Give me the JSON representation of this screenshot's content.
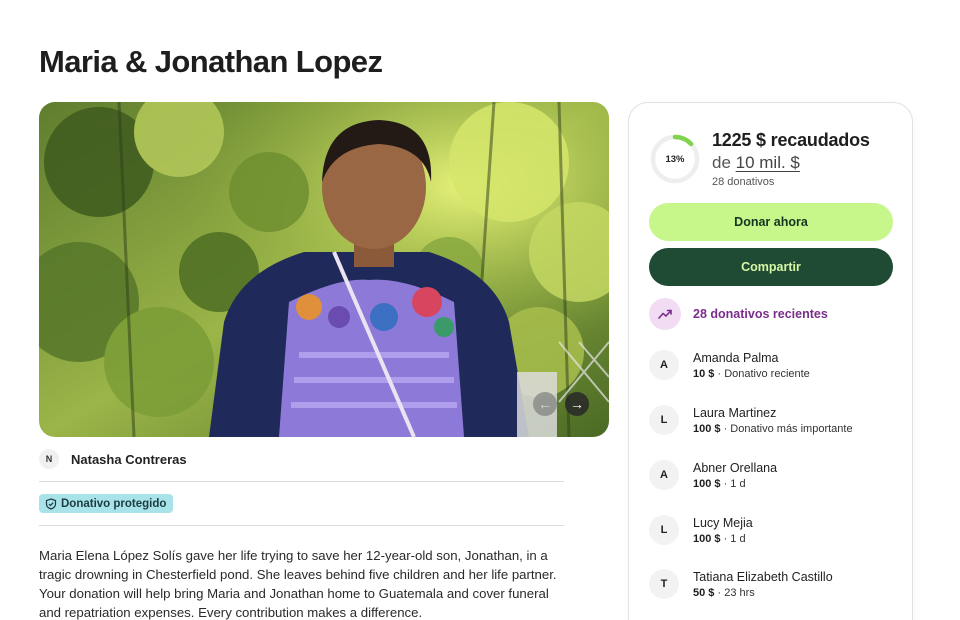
{
  "title": "Maria & Jonathan Lopez",
  "organizer": {
    "initial": "N",
    "name": "Natasha Contreras"
  },
  "badge": {
    "label": "Donativo protegido"
  },
  "description": "Maria Elena López Solís gave her life trying to save her 12-year-old son, Jonathan, in a tragic drowning in Chesterfield pond. She leaves behind five children and her life partner. Your donation will help bring Maria and Jonathan home to Guatemala and cover funeral and repatriation expenses. Every contribution makes a difference.",
  "gallery": {
    "prev_icon": "←",
    "next_icon": "→"
  },
  "progress": {
    "percent_label": "13%",
    "percent": 13,
    "raised": "1225 $ recaudados",
    "goal_prefix": "de ",
    "goal_amount": "10 mil. $",
    "donations_count": "28 donativos"
  },
  "buttons": {
    "donate": "Donar ahora",
    "share": "Compartir"
  },
  "recent": {
    "label": "28 donativos recientes"
  },
  "donors": [
    {
      "initial": "A",
      "name": "Amanda Palma",
      "amount": "10 $",
      "meta": " · Donativo reciente"
    },
    {
      "initial": "L",
      "name": "Laura Martinez",
      "amount": "100 $",
      "meta": " · Donativo más importante"
    },
    {
      "initial": "A",
      "name": "Abner Orellana",
      "amount": "100 $",
      "meta": " · 1 d"
    },
    {
      "initial": "L",
      "name": "Lucy Mejia",
      "amount": "100 $",
      "meta": " · 1 d"
    },
    {
      "initial": "T",
      "name": "Tatiana Elizabeth Castillo",
      "amount": "50 $",
      "meta": " · 23 hrs"
    }
  ],
  "colors": {
    "donate_bg": "#c7f68b",
    "share_bg": "#1f4a33",
    "progress_accent": "#7fd34f",
    "badge_bg": "#a7e3e8",
    "recent_accent": "#7a2e8c"
  }
}
